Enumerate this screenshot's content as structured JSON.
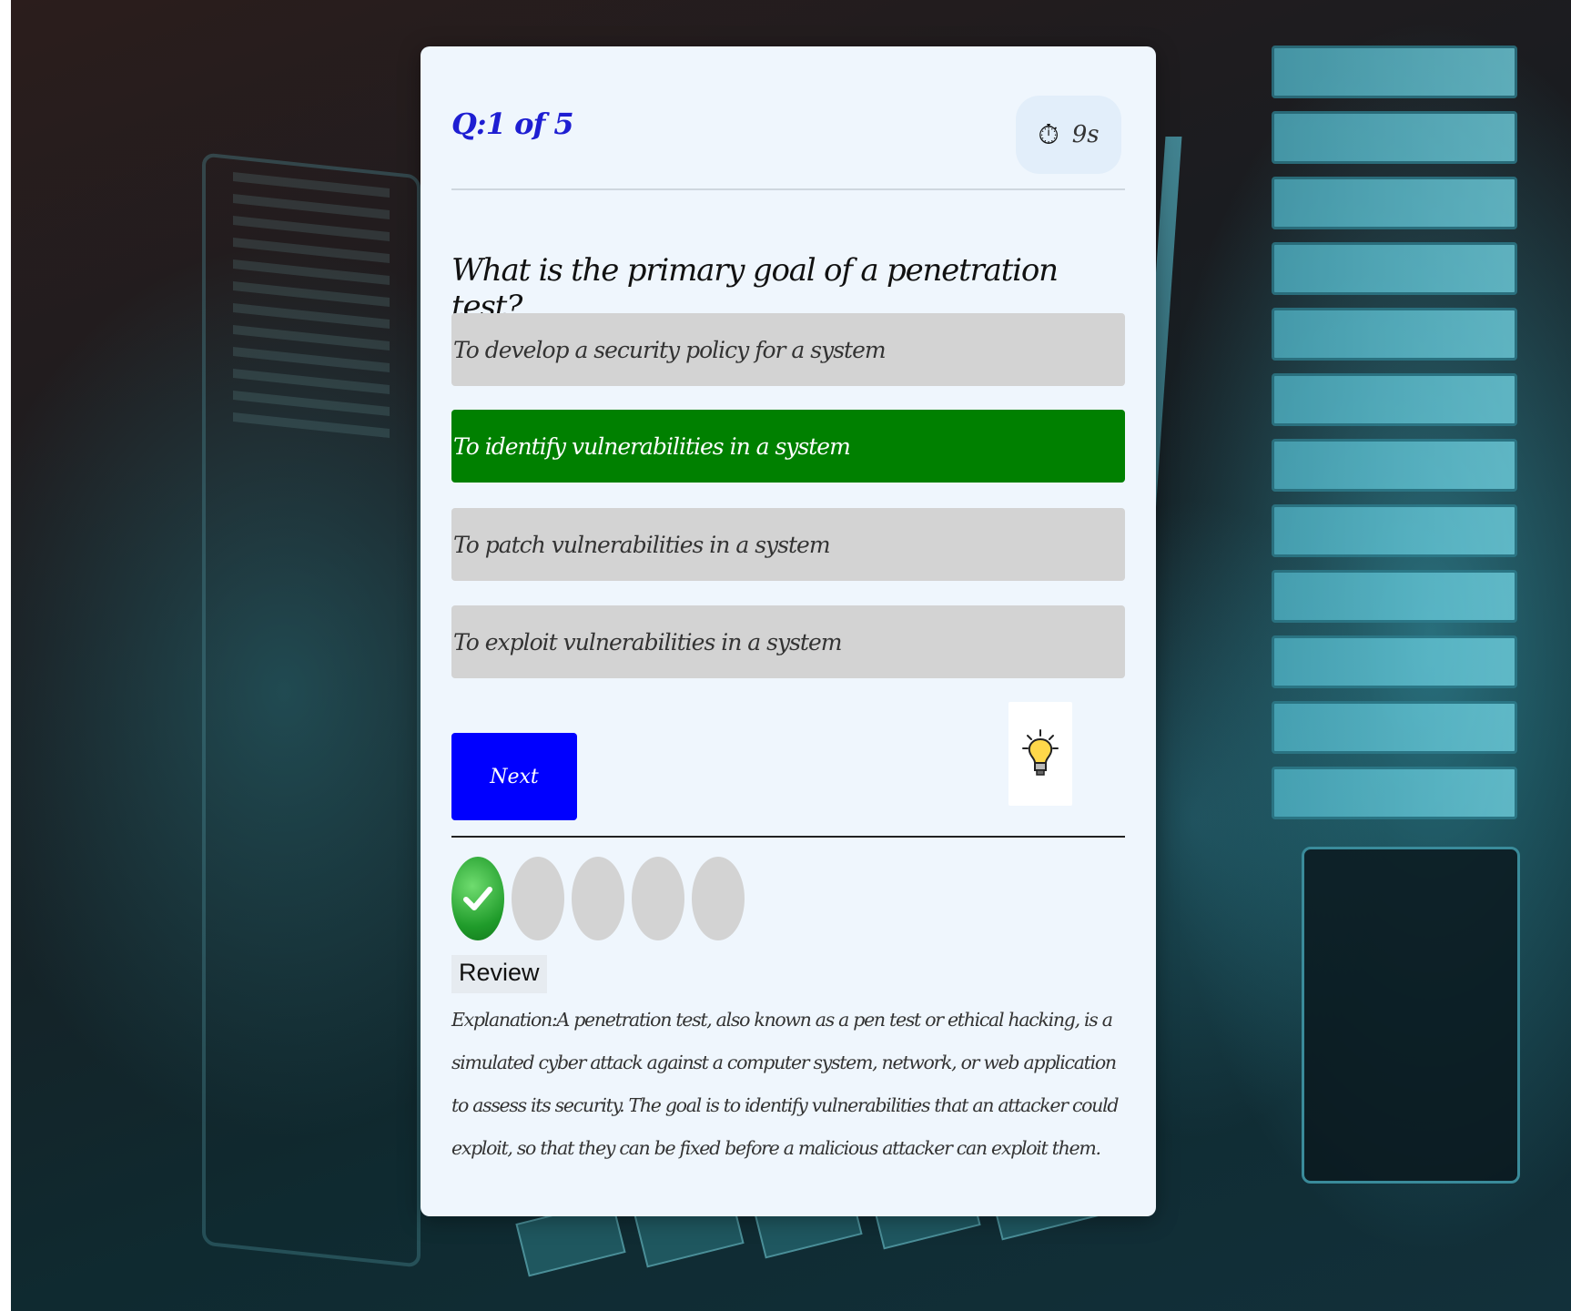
{
  "quiz": {
    "counter": "Q:1 of 5",
    "timer": {
      "icon": "stopwatch-icon",
      "value": "9s"
    },
    "question": "What is the primary goal of a penetration test?",
    "options": [
      {
        "label": "To develop a security policy for a system",
        "state": "neutral"
      },
      {
        "label": "To identify vulnerabilities in a system",
        "state": "correct"
      },
      {
        "label": "To patch vulnerabilities in a system",
        "state": "neutral"
      },
      {
        "label": "To exploit vulnerabilities in a system",
        "state": "neutral"
      }
    ],
    "next_label": "Next",
    "hint_icon": "lightbulb-icon",
    "progress": {
      "total": 5,
      "answered": 1,
      "answered_icon": "check-icon"
    },
    "review": {
      "title": "Review",
      "explanation": "Explanation:A penetration test, also known as a pen test or ethical hacking, is a simulated cyber attack against a computer system, network, or web application to assess its security. The goal is to identify vulnerabilities that an attacker could exploit, so that they can be fixed before a malicious attacker can exploit them."
    }
  },
  "colors": {
    "accent_blue": "#0000ff",
    "counter_blue": "#1e1ed2",
    "correct_green": "#008000",
    "option_gray": "#d3d3d3",
    "card_bg": "#eff6fd"
  }
}
